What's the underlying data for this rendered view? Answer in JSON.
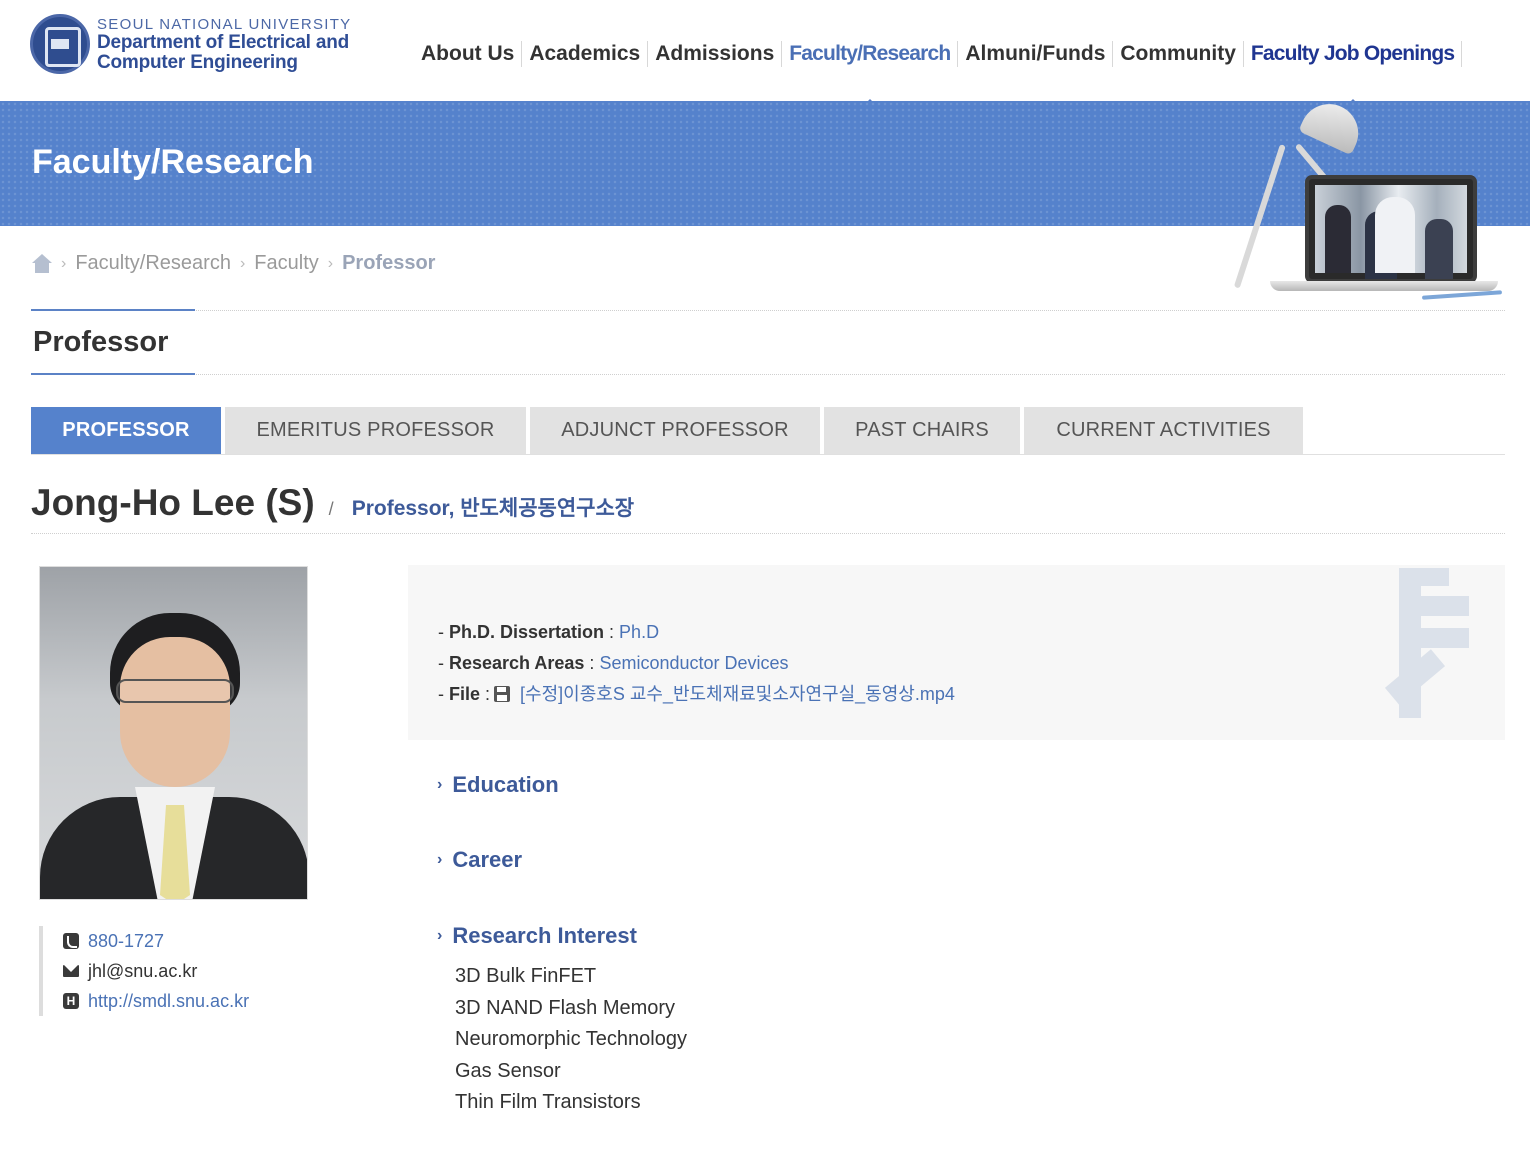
{
  "logo": {
    "university": "SEOUL NATIONAL UNIVERSITY",
    "department_line1": "Department of Electrical and",
    "department_line2": "Computer Engineering"
  },
  "nav": {
    "items": [
      "About Us",
      "Academics",
      "Admissions",
      "Faculty/Research",
      "Almuni/Funds",
      "Community",
      "Faculty Job Openings"
    ],
    "active": "Faculty/Research"
  },
  "banner": {
    "title": "Faculty/Research"
  },
  "breadcrumb": {
    "items": [
      "Faculty/Research",
      "Faculty",
      "Professor"
    ]
  },
  "page_title": "Professor",
  "tabs": [
    "PROFESSOR",
    "EMERITUS PROFESSOR",
    "ADJUNCT PROFESSOR",
    "PAST CHAIRS",
    "CURRENT ACTIVITIES"
  ],
  "professor": {
    "name": "Jong-Ho Lee (S)",
    "separator": "/",
    "position": "Professor, 반도체공동연구소장",
    "phone": "880-1727",
    "email": "jhl@snu.ac.kr",
    "homepage": "http://smdl.snu.ac.kr"
  },
  "info": {
    "phd_label": "Ph.D. Dissertation",
    "phd_value": "Ph.D",
    "areas_label": "Research Areas",
    "areas_value": "Semiconductor Devices",
    "file_label": "File",
    "file_value": "[수정]이종호S 교수_반도체재료및소자연구실_동영상.mp4"
  },
  "sections": {
    "education": "Education",
    "career": "Career",
    "research_interest": "Research Interest",
    "interests": [
      "3D Bulk FinFET",
      "3D NAND Flash Memory",
      "Neuromorphic Technology",
      "Gas Sensor",
      "Thin Film Transistors"
    ]
  },
  "colors": {
    "primary": "#5582cc",
    "accent_nav": "#1f3591",
    "link": "#4a72b5",
    "heading": "#3d5a99"
  }
}
